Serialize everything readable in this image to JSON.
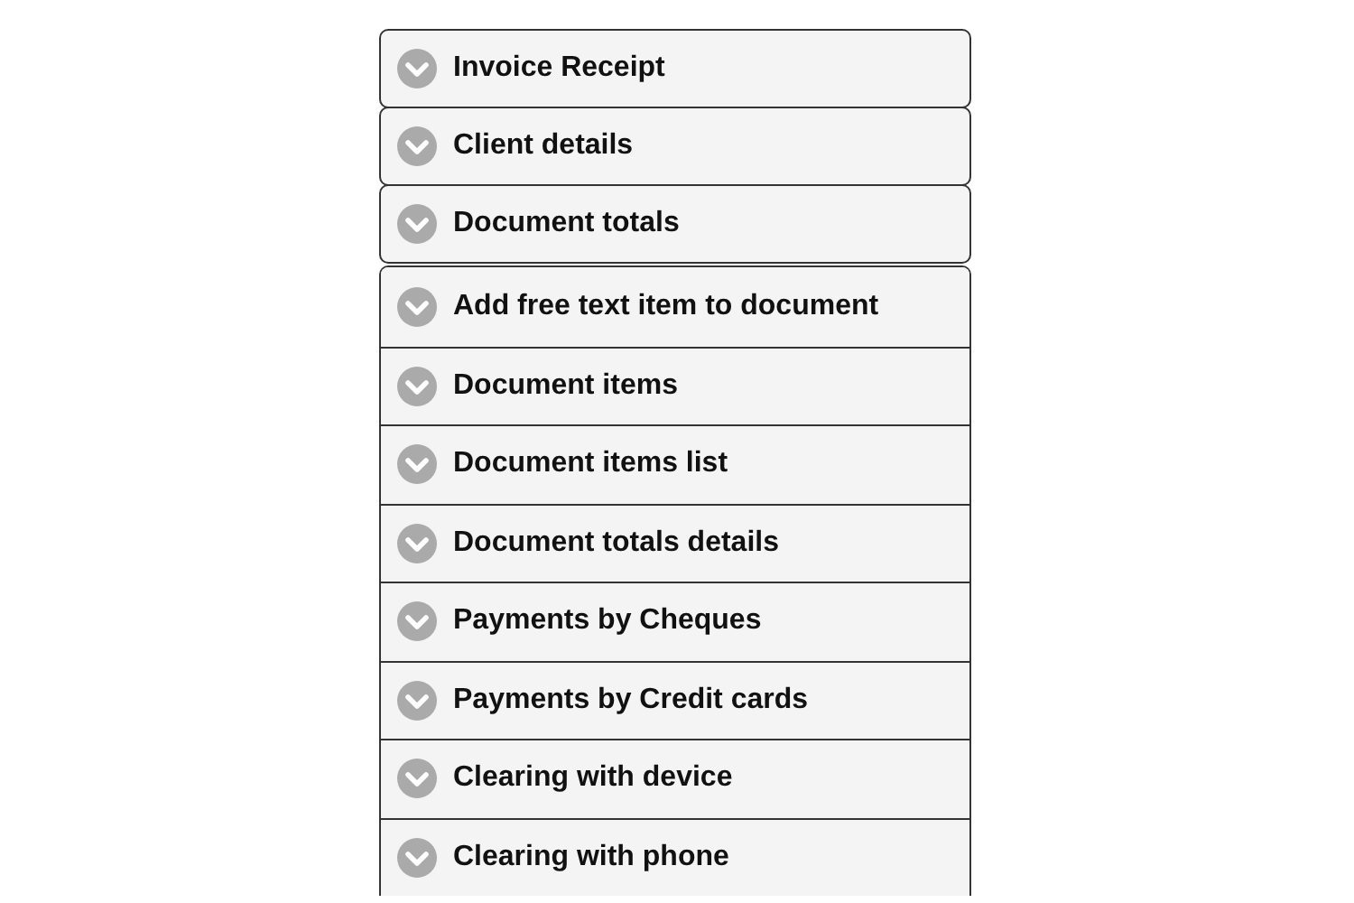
{
  "collapsibles": [
    {
      "title": "Invoice Receipt",
      "expanded": false
    },
    {
      "title": "Client details",
      "expanded": false
    },
    {
      "title": "Document totals",
      "expanded": false
    }
  ],
  "collapsible_set": [
    {
      "title": "Add free text item to document",
      "expanded": false
    },
    {
      "title": "Document items",
      "expanded": false
    },
    {
      "title": "Document items list",
      "expanded": false
    },
    {
      "title": "Document totals details",
      "expanded": false
    },
    {
      "title": "Payments by Cheques",
      "expanded": false
    },
    {
      "title": "Payments by Credit cards",
      "expanded": false
    },
    {
      "title": "Clearing with device",
      "expanded": false
    },
    {
      "title": "Clearing with phone",
      "expanded": false
    }
  ]
}
